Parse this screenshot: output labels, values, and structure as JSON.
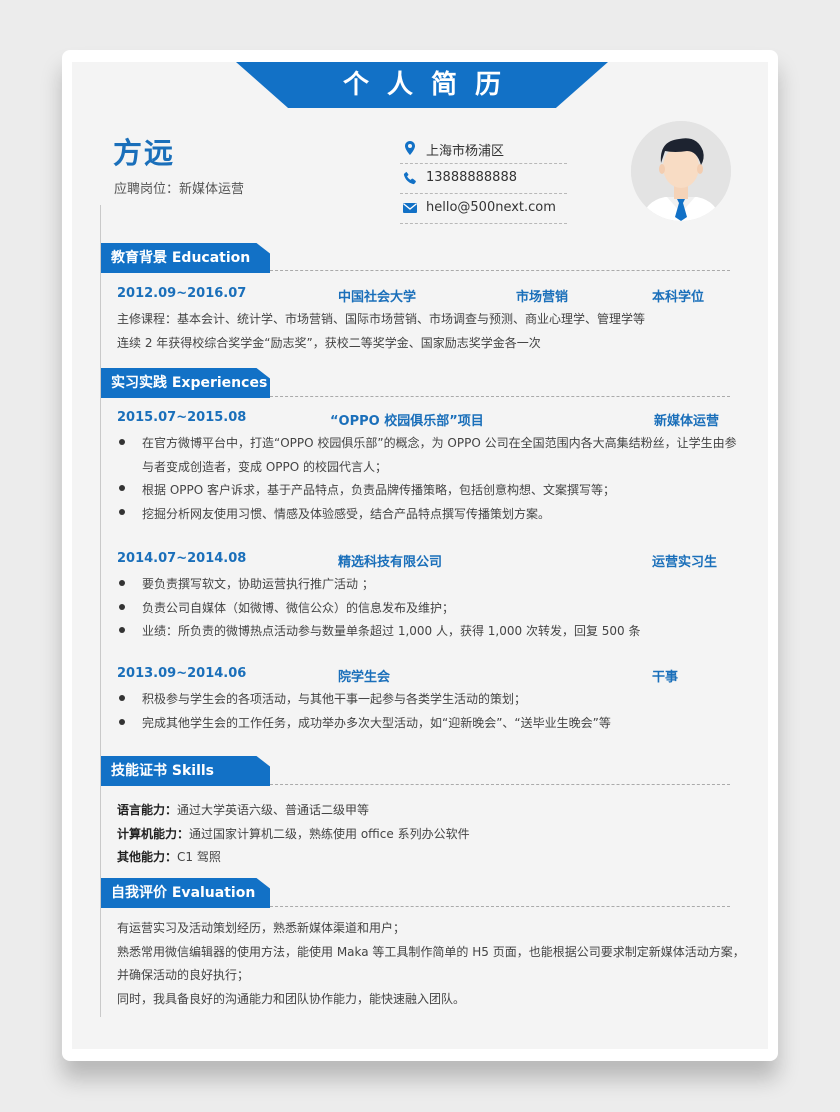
{
  "header": {
    "title": "个人简历",
    "name": "方远",
    "position_label": "应聘岗位：",
    "position_value": "新媒体运营"
  },
  "contacts": [
    {
      "icon": "location-pin-icon",
      "text": "上海市杨浦区"
    },
    {
      "icon": "phone-icon",
      "text": "13888888888"
    },
    {
      "icon": "mail-icon",
      "text": "hello@500next.com"
    }
  ],
  "sections": {
    "education": {
      "title": "教育背景  Education",
      "period": "2012.09~2016.07",
      "school": "中国社会大学",
      "major": "市场营销",
      "degree": "本科学位",
      "lines": [
        "主修课程：基本会计、统计学、市场营销、国际市场营销、市场调查与预测、商业心理学、管理学等",
        "连续 2 年获得校综合奖学金“励志奖”，获校二等奖学金、国家励志奖学金各一次"
      ]
    },
    "experience": {
      "title": "实习实践  Experiences",
      "items": [
        {
          "period": "2015.07~2015.08",
          "org": "“OPPO 校园俱乐部”项目",
          "role": "新媒体运营",
          "bullets": [
            "在官方微博平台中，打造“OPPO 校园俱乐部”的概念，为 OPPO 公司在全国范围内各大高集结粉丝，让学生由参",
            "与者变成创造者，变成 OPPO 的校园代言人；",
            "根据 OPPO 客户诉求，基于产品特点，负责品牌传播策略，包括创意构想、文案撰写等；",
            "挖掘分析网友使用习惯、情感及体验感受，结合产品特点撰写传播策划方案。"
          ]
        },
        {
          "period": "2014.07~2014.08",
          "org": "精选科技有限公司",
          "role": "运营实习生",
          "bullets": [
            "要负责撰写软文，协助运营执行推广活动 ；",
            "负责公司自媒体（如微博、微信公众）的信息发布及维护；",
            "业绩：所负责的微博热点活动参与数量单条超过 1,000 人，获得 1,000 次转发，回复 500 条"
          ]
        },
        {
          "period": "2013.09~2014.06",
          "org": "院学生会",
          "role": "干事",
          "bullets": [
            "积极参与学生会的各项活动，与其他干事一起参与各类学生活动的策划；",
            "完成其他学生会的工作任务，成功举办多次大型活动，如“迎新晚会”、“送毕业生晚会”等"
          ]
        }
      ]
    },
    "skills": {
      "title": "技能证书  Skills",
      "items": [
        {
          "label": "语言能力：",
          "value": "通过大学英语六级、普通话二级甲等"
        },
        {
          "label": "计算机能力：",
          "value": "通过国家计算机二级，熟练使用 office 系列办公软件"
        },
        {
          "label": "其他能力：",
          "value": "C1 驾照"
        }
      ]
    },
    "evaluation": {
      "title": "自我评价  Evaluation",
      "lines": [
        "有运营实习及活动策划经历，熟悉新媒体渠道和用户；",
        "熟悉常用微信编辑器的使用方法，能使用 Maka 等工具制作简单的 H5 页面，也能根据公司要求制定新媒体活动方案，",
        "并确保活动的良好执行；",
        "同时，我具备良好的沟通能力和团队协作能力，能快速融入团队。"
      ]
    }
  },
  "colors": {
    "accent": "#1271c6",
    "heading_blue": "#1a6fba",
    "sheet_bg": "#f4f4f4"
  }
}
